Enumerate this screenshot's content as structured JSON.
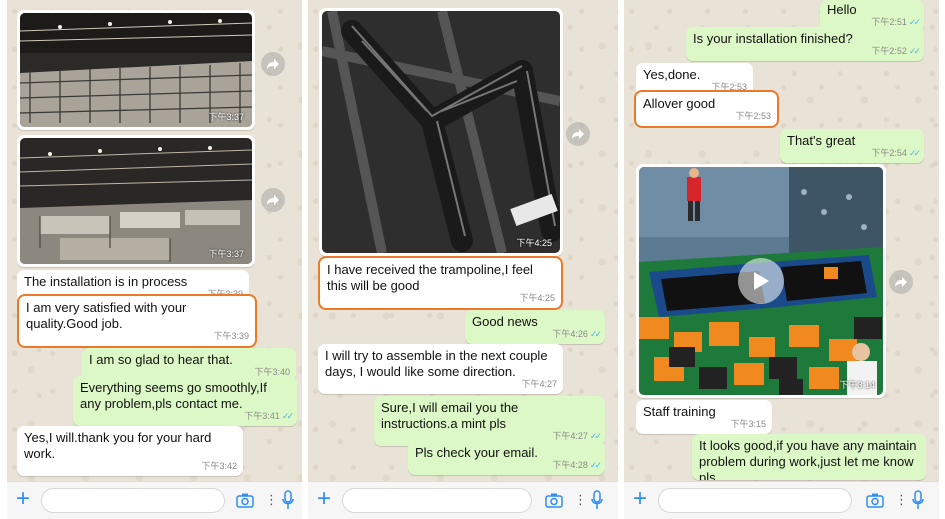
{
  "panel1": {
    "image1_time": "下午3:37",
    "image2_time": "下午3:37",
    "messages": [
      {
        "text": "The installation is in process",
        "time": "下午3:39"
      },
      {
        "text": "I am very satisfied with your quality.Good job.",
        "time": "下午3:39"
      },
      {
        "text": "I am so glad to hear that.",
        "time": "下午3:40"
      },
      {
        "text": "Everything seems go smoothly,If any problem,pls contact me.",
        "time": "下午3:41"
      },
      {
        "text": "Yes,I will.thank you for your hard work.",
        "time": "下午3:42"
      }
    ]
  },
  "panel2": {
    "image_time": "下午4:25",
    "messages": [
      {
        "text": "I have received the trampoline,I feel this will be good",
        "time": "下午4:25"
      },
      {
        "text": "Good news",
        "time": "下午4:26"
      },
      {
        "text": "I will try to assemble in the next couple days, I would like some direction.",
        "time": "下午4:27"
      },
      {
        "text": "Sure,I will email you the instructions.a mint pls",
        "time": "下午4:27"
      },
      {
        "text": "Pls check your email.",
        "time": "下午4:28"
      }
    ]
  },
  "panel3": {
    "video_time": "下午3:14",
    "messages": [
      {
        "text": "Hello",
        "time": "下午2:51"
      },
      {
        "text": "Is your installation finished?",
        "time": "下午2:52"
      },
      {
        "text": "Yes,done.",
        "time": "下午2:53"
      },
      {
        "text": "Allover good",
        "time": "下午2:53"
      },
      {
        "text": "That's great",
        "time": "下午2:54"
      },
      {
        "text": "Staff training",
        "time": "下午3:15"
      },
      {
        "text": "It looks good,if you have any maintain problem during work,just let me know pls",
        "time": ""
      }
    ]
  },
  "icons": {
    "plus": "+",
    "more": "⋮"
  },
  "colors": {
    "incoming_bubble": "#ffffff",
    "outgoing_bubble": "#dcf8c6",
    "highlight": "#ea7a2a",
    "accent": "#2f8ef5",
    "read_tick": "#4fb6ec"
  }
}
